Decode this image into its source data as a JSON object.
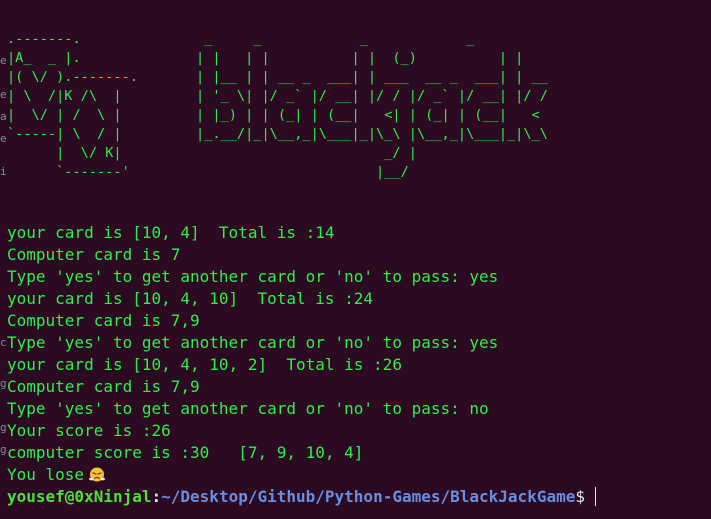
{
  "window": {
    "left_edge_glyphs": [
      "e",
      "e",
      "a",
      "e",
      "i",
      "c",
      "g",
      "g",
      "g"
    ],
    "colors": {
      "background": "#2b0a22",
      "output_text": "#2ef04a",
      "prompt_user": "#4ee03a",
      "prompt_path": "#6a8fe0",
      "prompt_symbol": "#e8e8e8"
    }
  },
  "banner": {
    "card_art": ".-------.\n|A_  _ |.\n|( \\/ ).-------.\n| \\  /|K /\\  |\n|  \\/ | /  \\ |\n`-----| \\  / |\n      |  \\/ K|\n      `-------'",
    "title_art": " _     _            _            _     \n| |   | |          | |  (_)          | |\n| |__ | | __ _  ___| | ___  __ _  ___| | __\n| '_ \\| |/ _` |/ __| |/ / |/ _` |/ __| |/ /\n| |_) | | (_| | (__|   <| | (_| | (__|   <\n|_.__/|_|\\__,_|\\___|_|\\_\\ |\\__,_|\\___|_|\\_\\\n                       _/ |\n                      |__/"
  },
  "output": {
    "lines": [
      "your card is [10, 4]  Total is :14",
      "Computer card is 7",
      "Type 'yes' to get another card or 'no' to pass: yes",
      "your card is [10, 4, 10]  Total is :24",
      "Computer card is 7,9",
      "Type 'yes' to get another card or 'no' to pass: yes",
      "your card is [10, 4, 10, 2]  Total is :26",
      "Computer card is 7,9",
      "Type 'yes' to get another card or 'no' to pass: no",
      "Your score is :26",
      "computer score is :30   [7, 9, 10, 4]"
    ],
    "result_text": "You lose",
    "result_emoji_icon": "steam-from-nose-face-icon"
  },
  "prompt": {
    "user_host": "yousef@0xNinjal",
    "colon": ":",
    "path": "~/Desktop/Github/Python-Games/BlackJackGame",
    "symbol": "$"
  }
}
